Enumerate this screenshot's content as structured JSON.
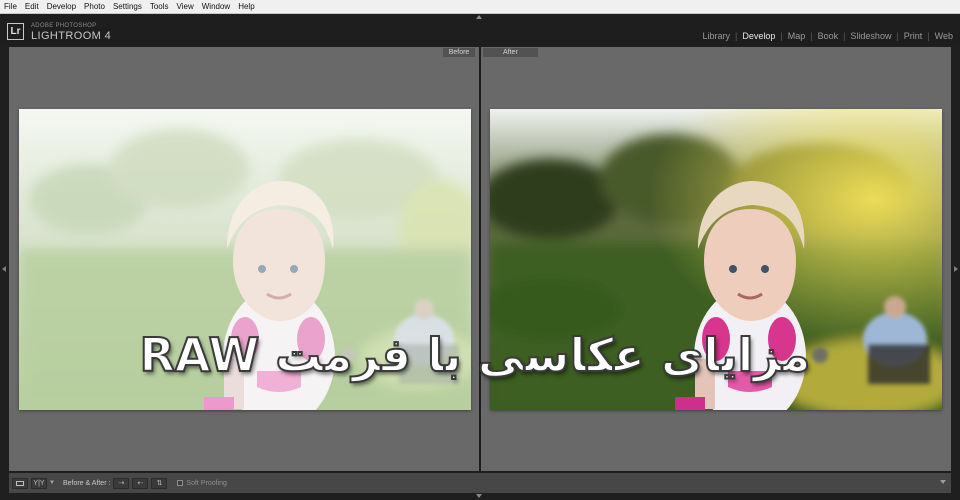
{
  "menu": [
    "File",
    "Edit",
    "Develop",
    "Photo",
    "Settings",
    "Tools",
    "View",
    "Window",
    "Help"
  ],
  "brand": {
    "logo": "Lr",
    "vendor": "ADOBE PHOTOSHOP",
    "product": "LIGHTROOM 4"
  },
  "modules": [
    {
      "label": "Library",
      "active": false
    },
    {
      "label": "Develop",
      "active": true
    },
    {
      "label": "Map",
      "active": false
    },
    {
      "label": "Book",
      "active": false
    },
    {
      "label": "Slideshow",
      "active": false
    },
    {
      "label": "Print",
      "active": false
    },
    {
      "label": "Web",
      "active": false
    }
  ],
  "view": {
    "before_label": "Before",
    "after_label": "After"
  },
  "overlay_text": "مزایای عکاسی با فرمت RAW",
  "toolbar": {
    "view_mode_icon": "loupe-view-icon",
    "yy_label": "Y|Y",
    "before_after_label": "Before & After :",
    "soft_proofing_label": "Soft Proofing"
  },
  "colors": {
    "accent_active": "#e8e8e8",
    "panel_bg": "#696969",
    "toolbar_bg": "#474747"
  }
}
